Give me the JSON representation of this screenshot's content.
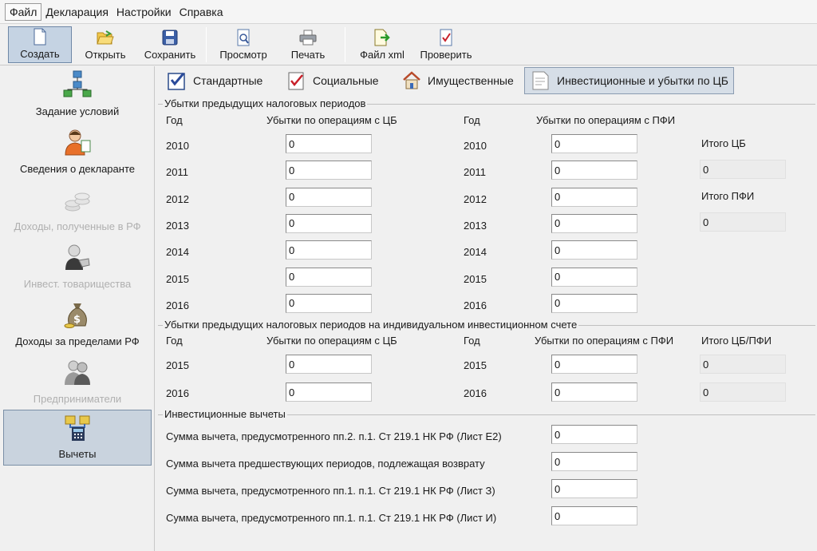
{
  "menu": [
    "Файл",
    "Декларация",
    "Настройки",
    "Справка"
  ],
  "toolbar": {
    "create": "Создать",
    "open": "Открыть",
    "save": "Сохранить",
    "preview": "Просмотр",
    "print": "Печать",
    "xml": "Файл xml",
    "check": "Проверить"
  },
  "sidebar": {
    "items": [
      {
        "label": "Задание условий",
        "icon": "network-icon",
        "enabled": true
      },
      {
        "label": "Сведения о декларанте",
        "icon": "person-icon",
        "enabled": true
      },
      {
        "label": "Доходы, полученные в РФ",
        "icon": "coins-icon",
        "enabled": false
      },
      {
        "label": "Инвест. товарищества",
        "icon": "handshake-icon",
        "enabled": false
      },
      {
        "label": "Доходы за пределами РФ",
        "icon": "money-bag-icon",
        "enabled": true
      },
      {
        "label": "Предприниматели",
        "icon": "businessman-icon",
        "enabled": false
      },
      {
        "label": "Вычеты",
        "icon": "calculator-icon",
        "enabled": true,
        "selected": true
      }
    ]
  },
  "tabs": [
    {
      "label": "Стандартные",
      "icon": "checklist-icon"
    },
    {
      "label": "Социальные",
      "icon": "checkmark-doc-icon"
    },
    {
      "label": "Имущественные",
      "icon": "house-icon"
    },
    {
      "label": "Инвестиционные и убытки по ЦБ",
      "icon": "doc-icon",
      "selected": true
    }
  ],
  "losses": {
    "title": "Убытки предыдущих налоговых периодов",
    "year_header": "Год",
    "cb_header": "Убытки по операциям с ЦБ",
    "pfi_header": "Убытки по операциям с ПФИ",
    "rows": [
      {
        "year": "2010",
        "cb": "0",
        "pfi": "0"
      },
      {
        "year": "2011",
        "cb": "0",
        "pfi": "0"
      },
      {
        "year": "2012",
        "cb": "0",
        "pfi": "0"
      },
      {
        "year": "2013",
        "cb": "0",
        "pfi": "0"
      },
      {
        "year": "2014",
        "cb": "0",
        "pfi": "0"
      },
      {
        "year": "2015",
        "cb": "0",
        "pfi": "0"
      },
      {
        "year": "2016",
        "cb": "0",
        "pfi": "0"
      }
    ],
    "total_cb_label": "Итого ЦБ",
    "total_cb": "0",
    "total_pfi_label": "Итого ПФИ",
    "total_pfi": "0"
  },
  "iis": {
    "title": "Убытки предыдущих налоговых периодов на индивидуальном инвестиционном счете",
    "year_header": "Год",
    "cb_header": "Убытки по операциям с ЦБ",
    "pfi_header": "Убытки по операциям с ПФИ",
    "total_header": "Итого ЦБ/ПФИ",
    "rows": [
      {
        "year": "2015",
        "cb": "0",
        "pfi": "0",
        "total": "0"
      },
      {
        "year": "2016",
        "cb": "0",
        "pfi": "0",
        "total": "0"
      }
    ]
  },
  "deductions": {
    "title": "Инвестиционные вычеты",
    "rows": [
      {
        "label": "Сумма вычета, предусмотренного пп.2. п.1. Ст 219.1 НК РФ (Лист Е2)",
        "value": "0"
      },
      {
        "label": "Сумма вычета предшествующих периодов, подлежащая возврату",
        "value": "0"
      },
      {
        "label": "Сумма вычета, предусмотренного пп.1. п.1. Ст 219.1 НК РФ (Лист З)",
        "value": "0"
      },
      {
        "label": "Сумма вычета, предусмотренного пп.1. п.1. Ст 219.1 НК РФ (Лист И)",
        "value": "0"
      }
    ]
  }
}
